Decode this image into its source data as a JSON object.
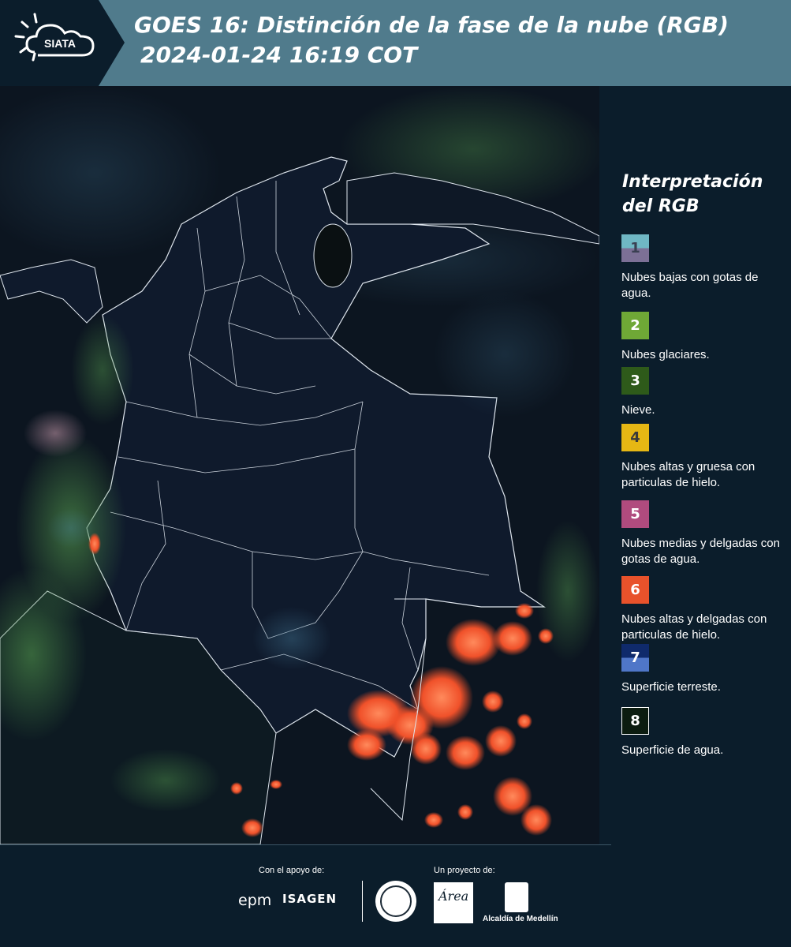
{
  "header": {
    "logo_text": "SIATA",
    "title": "GOES 16: Distinción de la fase de la nube (RGB)",
    "subtitle": "2024-01-24 16:19 COT",
    "background_color": "#507b8c"
  },
  "legend": {
    "title": "Interpretación del RGB",
    "items": [
      {
        "number": "1",
        "label": "Nubes bajas con gotas de agua.",
        "color_top": "#6fb7c4",
        "color_bottom": "#7c7096",
        "number_color": "#3a3f52"
      },
      {
        "number": "2",
        "label": "Nubes glaciares.",
        "color_top": "#6fa836",
        "color_bottom": "#6fa836",
        "number_color": "#ffffff"
      },
      {
        "number": "3",
        "label": "Nieve.",
        "color_top": "#2e5a1a",
        "color_bottom": "#2e5a1a",
        "number_color": "#ffffff"
      },
      {
        "number": "4",
        "label": "Nubes altas y gruesa con particulas de hielo.",
        "color_top": "#e6b714",
        "color_bottom": "#e6b714",
        "number_color": "#3a3a3a"
      },
      {
        "number": "5",
        "label": "Nubes medias y delgadas con gotas de agua.",
        "color_top": "#b04b7e",
        "color_bottom": "#b04b7e",
        "number_color": "#ffffff"
      },
      {
        "number": "6",
        "label": "Nubes altas y delgadas con particulas de hielo.",
        "color_top": "#e8522b",
        "color_bottom": "#e8522b",
        "number_color": "#ffffff"
      },
      {
        "number": "7",
        "label": "Superficie terreste.",
        "color_top": "#0f2a6b",
        "color_bottom": "#4f76c8",
        "number_color": "#ffffff"
      },
      {
        "number": "8",
        "label": "Superficie de agua.",
        "color_top": "#0c1c10",
        "color_bottom": "#0c1c10",
        "number_color": "#ffffff"
      }
    ]
  },
  "footer": {
    "support_label": "Con el apoyo de:",
    "project_label": "Un proyecto de:",
    "sponsor_1": "epm",
    "sponsor_2": "ISAGEN",
    "partner_2_text": "Área",
    "partner_3": "Alcaldía de Medellín"
  }
}
